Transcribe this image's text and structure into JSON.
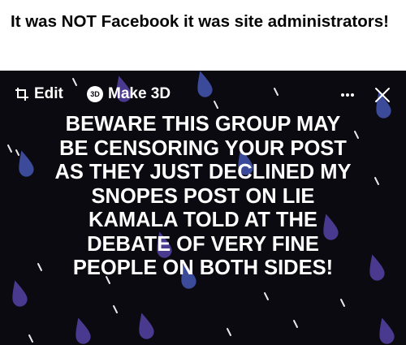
{
  "caption": "It was NOT Facebook it was site administrators!",
  "toolbar": {
    "edit_label": "Edit",
    "make3d_label": "Make 3D",
    "badge_3d": "3D",
    "more_icon": "ellipsis-icon",
    "close_icon": "close-icon"
  },
  "post_text": {
    "lines": [
      "BEWARE THIS GROUP MAY",
      "BE CENSORING YOUR POST",
      "AS THEY JUST DECLINED MY",
      "SNOPES POST ON LIE",
      "KAMALA TOLD AT THE",
      "DEBATE OF VERY FINE",
      "PEOPLE ON BOTH SIDES!"
    ]
  },
  "colors": {
    "background": "#0b0a10",
    "drop_purple": "#4a3a8f",
    "drop_blue": "#3b4b9a",
    "drop_white": "#e8e8f0",
    "text": "#ffffff"
  }
}
